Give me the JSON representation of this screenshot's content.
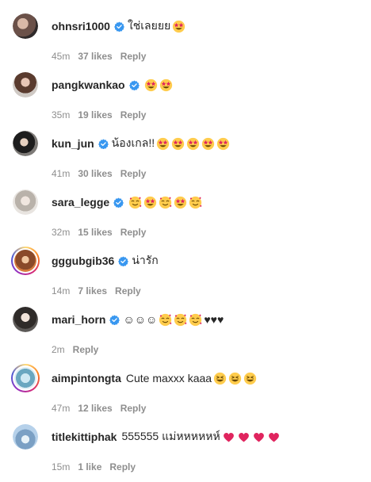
{
  "comments": [
    {
      "username": "ohnsri1000",
      "verified": true,
      "text": "ใช่เลยยย",
      "emojis": [
        "star-struck"
      ],
      "time": "45m",
      "likes": "37 likes",
      "reply": "Reply"
    },
    {
      "username": "pangkwankao",
      "verified": true,
      "text": "",
      "emojis": [
        "star-struck",
        "star-struck"
      ],
      "time": "35m",
      "likes": "19 likes",
      "reply": "Reply"
    },
    {
      "username": "kun_jun",
      "verified": true,
      "text": "น้องเกล!!",
      "emojis": [
        "star-struck",
        "star-struck",
        "star-struck",
        "star-struck",
        "star-struck"
      ],
      "time": "41m",
      "likes": "30 likes",
      "reply": "Reply"
    },
    {
      "username": "sara_legge",
      "verified": true,
      "text": "",
      "emojis": [
        "smiling-hearts",
        "star-struck",
        "smiling-hearts",
        "star-struck",
        "smiling-hearts"
      ],
      "time": "32m",
      "likes": "15 likes",
      "reply": "Reply"
    },
    {
      "username": "gggubgib36",
      "verified": true,
      "text": "น่ารัก",
      "emojis": [],
      "time": "14m",
      "likes": "7 likes",
      "reply": "Reply"
    },
    {
      "username": "mari_horn",
      "verified": true,
      "text": "☺☺☺",
      "emojis": [
        "smiling-hearts",
        "smiling-hearts",
        "smiling-hearts"
      ],
      "text_after": "♥♥♥",
      "time": "2m",
      "likes": "",
      "reply": "Reply"
    },
    {
      "username": "aimpintongta",
      "verified": false,
      "text": "Cute maxxx kaaa",
      "emojis": [
        "squinting-laugh",
        "squinting-laugh",
        "squinting-laugh"
      ],
      "time": "47m",
      "likes": "12 likes",
      "reply": "Reply"
    },
    {
      "username": "titlekittiphak",
      "verified": false,
      "text": "555555 แม่หหหหหห์",
      "emojis": [
        "red-heart",
        "red-heart",
        "red-heart",
        "red-heart"
      ],
      "time": "15m",
      "likes": "1 like",
      "reply": "Reply"
    }
  ],
  "colors": {
    "verified": "#3897f0",
    "meta": "#8e8e8e",
    "text": "#262626",
    "heart": "#e0245e",
    "emoji_face": "#ffcc4d"
  }
}
